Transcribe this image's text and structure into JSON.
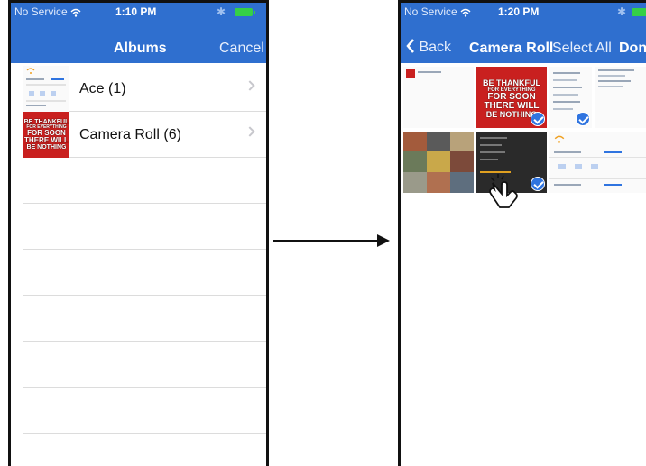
{
  "left_screen": {
    "status": {
      "carrier": "No Service",
      "time": "1:10 PM"
    },
    "nav": {
      "title": "Albums",
      "cancel_label": "Cancel"
    },
    "albums": [
      {
        "label": "Ace (1)"
      },
      {
        "label": "Camera Roll (6)"
      }
    ],
    "poster_lines": [
      "BE THANKFUL",
      "FOR EVERYTHING",
      "FOR SOON",
      "THERE WILL",
      "BE NOTHING"
    ]
  },
  "right_screen": {
    "status": {
      "carrier": "No Service",
      "time": "1:20 PM"
    },
    "nav": {
      "back_label": "Back",
      "title": "Camera Roll",
      "select_all_label": "Select All",
      "done_label": "Done"
    },
    "poster_lines": [
      "BE THANKFUL",
      "FOR EVERYTHING",
      "FOR SOON",
      "THERE WILL",
      "BE NOTHING"
    ],
    "selected_count": 3
  },
  "colors": {
    "nav_blue": "#2f6fcf",
    "battery_green": "#35d046",
    "check_blue": "#2f74e0",
    "poster_red": "#c9201f"
  },
  "icons": [
    "wifi-icon",
    "bluetooth-icon",
    "battery-icon",
    "chevron-right-icon",
    "chevron-left-icon",
    "checkmark-icon",
    "hand-pointer-icon",
    "arrow-right-icon"
  ]
}
